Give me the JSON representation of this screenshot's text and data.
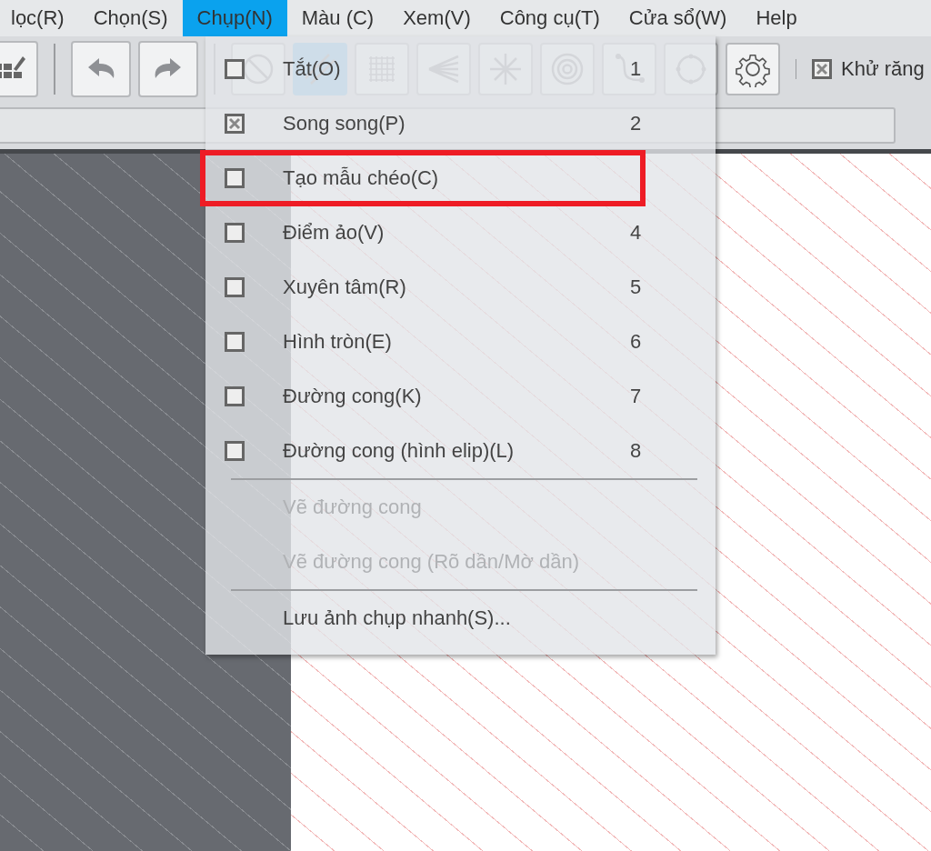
{
  "menubar": [
    {
      "label": "lọc(R)",
      "selected": false
    },
    {
      "label": "Chọn(S)",
      "selected": false
    },
    {
      "label": "Chụp(N)",
      "selected": true
    },
    {
      "label": "Màu (C)",
      "selected": false
    },
    {
      "label": "Xem(V)",
      "selected": false
    },
    {
      "label": "Công cụ(T)",
      "selected": false
    },
    {
      "label": "Cửa sổ(W)",
      "selected": false
    },
    {
      "label": "Help",
      "selected": false
    }
  ],
  "toolbar": {
    "buttons": [
      {
        "kind": "grid-edit",
        "selected": false
      },
      {
        "kind": "separator"
      },
      {
        "kind": "undo",
        "selected": false
      },
      {
        "kind": "redo",
        "selected": false
      },
      {
        "kind": "separator"
      },
      {
        "kind": "none",
        "selected": false
      },
      {
        "kind": "parallel",
        "selected": true
      },
      {
        "kind": "grid",
        "selected": false
      },
      {
        "kind": "fan",
        "selected": false
      },
      {
        "kind": "burst",
        "selected": false
      },
      {
        "kind": "rings",
        "selected": false
      },
      {
        "kind": "curve",
        "selected": false
      },
      {
        "kind": "ellipse",
        "selected": false
      },
      {
        "kind": "settings",
        "selected": false
      }
    ],
    "checkbox": {
      "label": "Khử răng",
      "checked": true
    }
  },
  "menu": {
    "items": [
      {
        "kind": "check",
        "label": "Tắt(O)",
        "checked": false,
        "shortcut": "1",
        "highlighted": false
      },
      {
        "kind": "check",
        "label": "Song song(P)",
        "checked": true,
        "shortcut": "2",
        "highlighted": false
      },
      {
        "kind": "check",
        "label": "Tạo mẫu chéo(C)",
        "checked": false,
        "highlighted": true
      },
      {
        "kind": "check",
        "label": "Điểm ảo(V)",
        "checked": false,
        "shortcut": "4",
        "highlighted": false
      },
      {
        "kind": "check",
        "label": "Xuyên tâm(R)",
        "checked": false,
        "shortcut": "5",
        "highlighted": false
      },
      {
        "kind": "check",
        "label": "Hình tròn(E)",
        "checked": false,
        "shortcut": "6",
        "highlighted": false
      },
      {
        "kind": "check",
        "label": "Đường cong(K)",
        "checked": false,
        "shortcut": "7",
        "highlighted": false
      },
      {
        "kind": "check",
        "label": "Đường cong (hình elip)(L)",
        "checked": false,
        "shortcut": "8",
        "highlighted": false
      },
      {
        "kind": "separator"
      },
      {
        "kind": "action",
        "label": "Vẽ đường cong",
        "disabled": true,
        "highlighted": false
      },
      {
        "kind": "action",
        "label": "Vẽ đường cong (Rõ dần/Mờ dần)",
        "disabled": true,
        "highlighted": false
      },
      {
        "kind": "separator"
      },
      {
        "kind": "action",
        "label": "Lưu ảnh chụp nhanh(S)...",
        "disabled": false,
        "highlighted": false
      }
    ]
  }
}
